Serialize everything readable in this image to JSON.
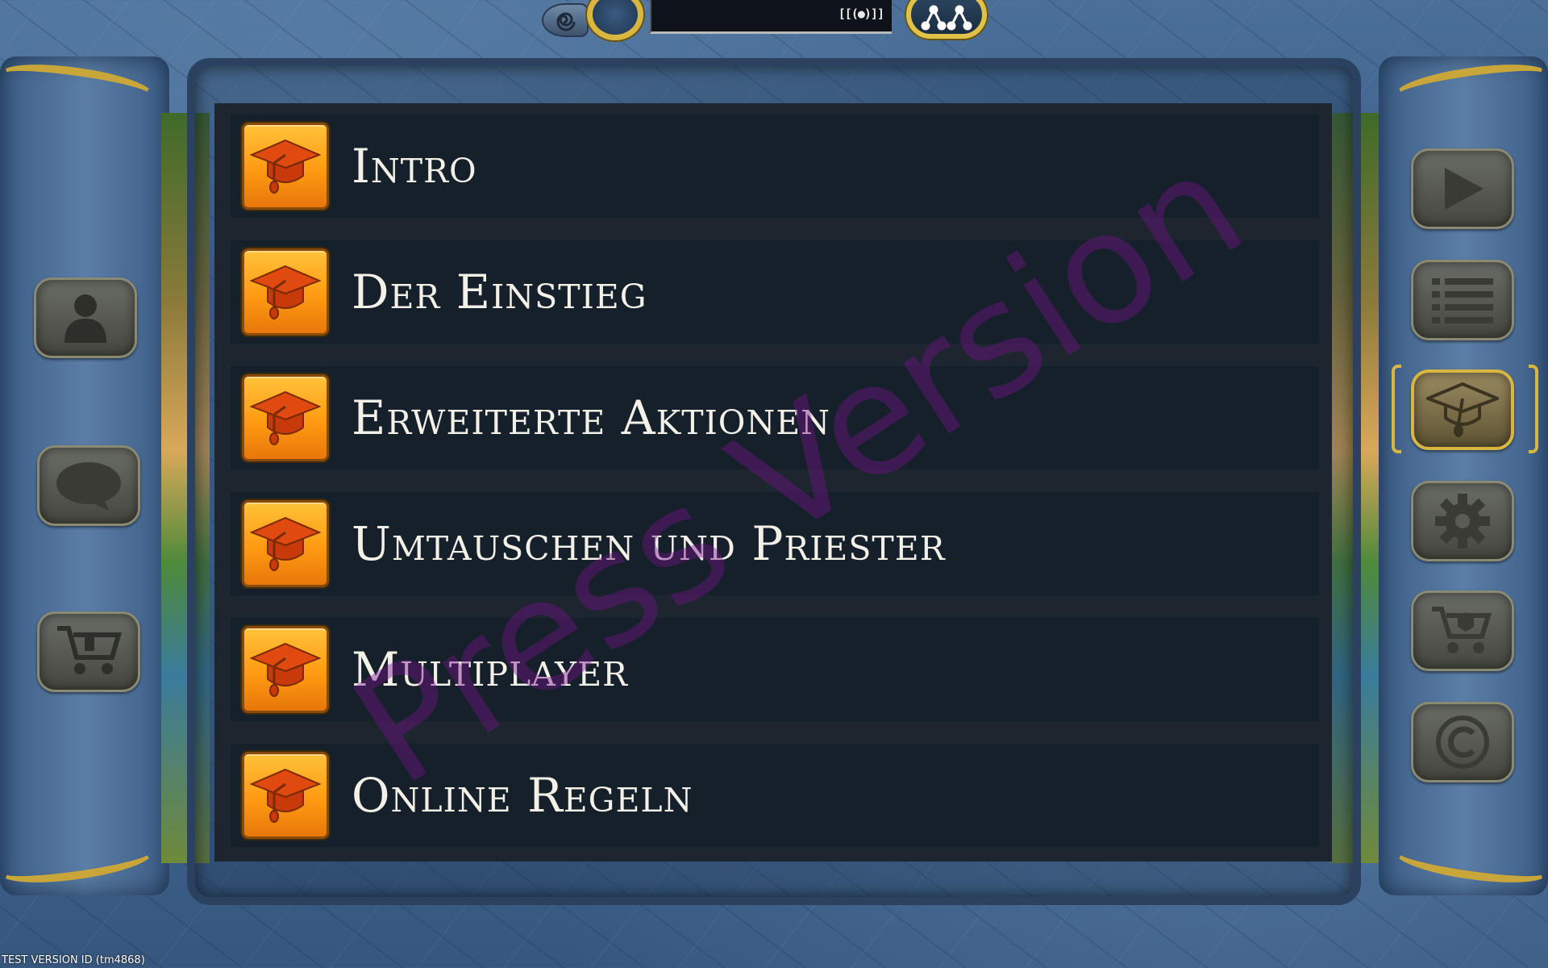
{
  "top_hud": {
    "signal_text": "[[(●)]]"
  },
  "menu": {
    "items": [
      {
        "label": "Intro",
        "icon": "graduation-cap-icon"
      },
      {
        "label": "Der Einstieg",
        "icon": "graduation-cap-icon"
      },
      {
        "label": "Erweiterte Aktionen",
        "icon": "graduation-cap-icon"
      },
      {
        "label": "Umtauschen und Priester",
        "icon": "graduation-cap-icon"
      },
      {
        "label": "Multiplayer",
        "icon": "graduation-cap-icon"
      },
      {
        "label": "Online Regeln",
        "icon": "graduation-cap-icon"
      }
    ]
  },
  "left_buttons": [
    {
      "icon": "profile-icon"
    },
    {
      "icon": "chat-bubble-icon"
    },
    {
      "icon": "shop-cart-icon"
    }
  ],
  "right_buttons": [
    {
      "icon": "play-icon",
      "active": false
    },
    {
      "icon": "list-icon",
      "active": false
    },
    {
      "icon": "tutorial-cap-icon",
      "active": true
    },
    {
      "icon": "gear-icon",
      "active": false
    },
    {
      "icon": "cart-icon",
      "active": false
    },
    {
      "icon": "copyright-icon",
      "active": false
    }
  ],
  "watermark": "Press Version",
  "footer": "TEST VERSION ID (tm4868)",
  "colors": {
    "accent_gold": "#d8b640",
    "icon_orange": "#ff9a12",
    "menu_bg": "#16202a",
    "label_text": "#f3f0e8",
    "watermark": "#78148c"
  }
}
